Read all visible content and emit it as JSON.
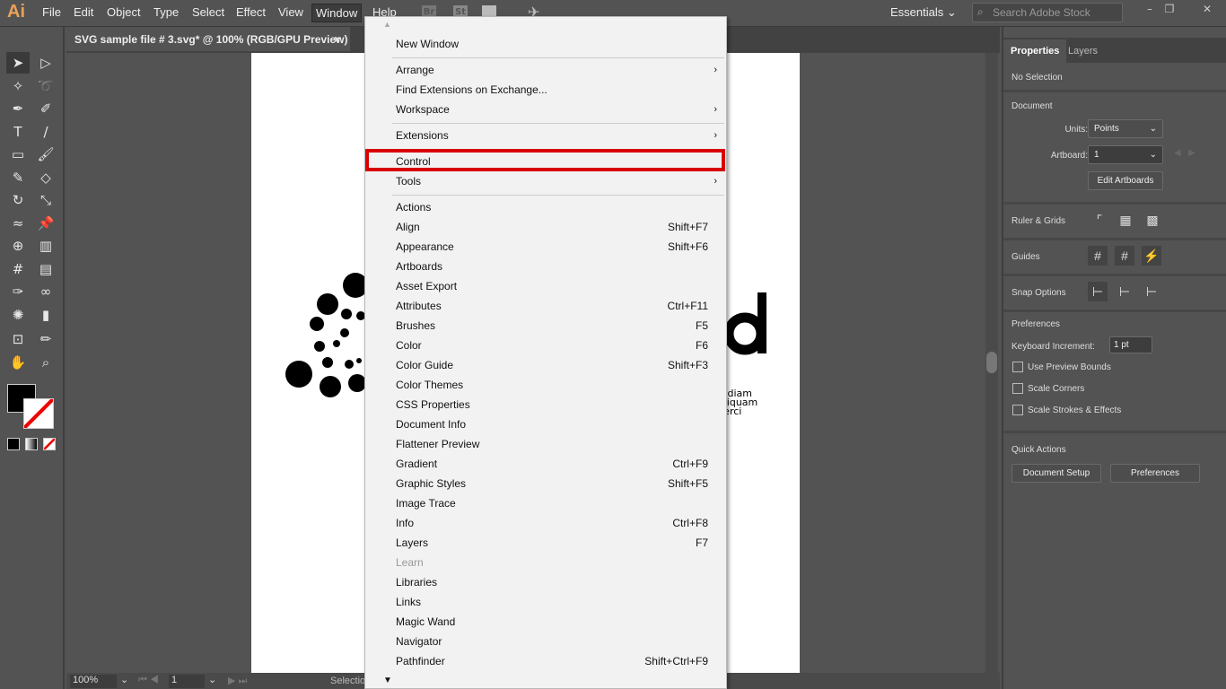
{
  "app": {
    "logo": "Ai",
    "menus": [
      "File",
      "Edit",
      "Object",
      "Type",
      "Select",
      "Effect",
      "View",
      "Window",
      "Help"
    ],
    "active_menu": "Window",
    "bridge_icon": "Br",
    "stock_icon": "St",
    "workspace": "Essentials",
    "search_placeholder": "Search Adobe Stock"
  },
  "document": {
    "tab_title": "SVG sample file # 3.svg* @ 100% (RGB/GPU Preview)",
    "close": "×",
    "artwork_text": [
      "d diam",
      "aliquam",
      "xerci"
    ]
  },
  "status": {
    "zoom": "100%",
    "artboard": "1",
    "tool": "Selection"
  },
  "panel": {
    "tabs": [
      "Properties",
      "Layers"
    ],
    "selection": "No Selection",
    "document_heading": "Document",
    "units_label": "Units:",
    "units_value": "Points",
    "artboard_label": "Artboard:",
    "artboard_value": "1",
    "edit_artboards": "Edit Artboards",
    "ruler_grids": "Ruler & Grids",
    "guides": "Guides",
    "snap_options": "Snap Options",
    "preferences_heading": "Preferences",
    "keyboard_increment_label": "Keyboard Increment:",
    "keyboard_increment_value": "1 pt",
    "checkboxes": [
      "Use Preview Bounds",
      "Scale Corners",
      "Scale Strokes & Effects"
    ],
    "quick_actions": "Quick Actions",
    "document_setup": "Document Setup",
    "preferences_button": "Preferences"
  },
  "window_menu": {
    "items": [
      {
        "label": "New Window"
      },
      {
        "sep": true
      },
      {
        "label": "Arrange",
        "sub": true
      },
      {
        "label": "Find Extensions on Exchange..."
      },
      {
        "label": "Workspace",
        "sub": true
      },
      {
        "sep": true
      },
      {
        "label": "Extensions",
        "sub": true
      },
      {
        "sep": true
      },
      {
        "label": "Control",
        "highlighted": true
      },
      {
        "label": "Tools",
        "sub": true
      },
      {
        "sep": true
      },
      {
        "label": "Actions"
      },
      {
        "label": "Align",
        "shortcut": "Shift+F7"
      },
      {
        "label": "Appearance",
        "shortcut": "Shift+F6"
      },
      {
        "label": "Artboards"
      },
      {
        "label": "Asset Export"
      },
      {
        "label": "Attributes",
        "shortcut": "Ctrl+F11"
      },
      {
        "label": "Brushes",
        "shortcut": "F5"
      },
      {
        "label": "Color",
        "shortcut": "F6"
      },
      {
        "label": "Color Guide",
        "shortcut": "Shift+F3"
      },
      {
        "label": "Color Themes"
      },
      {
        "label": "CSS Properties"
      },
      {
        "label": "Document Info"
      },
      {
        "label": "Flattener Preview"
      },
      {
        "label": "Gradient",
        "shortcut": "Ctrl+F9"
      },
      {
        "label": "Graphic Styles",
        "shortcut": "Shift+F5"
      },
      {
        "label": "Image Trace"
      },
      {
        "label": "Info",
        "shortcut": "Ctrl+F8"
      },
      {
        "label": "Layers",
        "shortcut": "F7"
      },
      {
        "label": "Learn",
        "disabled": true
      },
      {
        "label": "Libraries"
      },
      {
        "label": "Links"
      },
      {
        "label": "Magic Wand"
      },
      {
        "label": "Navigator"
      },
      {
        "label": "Pathfinder",
        "shortcut": "Shift+Ctrl+F9"
      }
    ]
  },
  "colors": {
    "highlight": "#d90000",
    "logo": "#e8a15a"
  }
}
